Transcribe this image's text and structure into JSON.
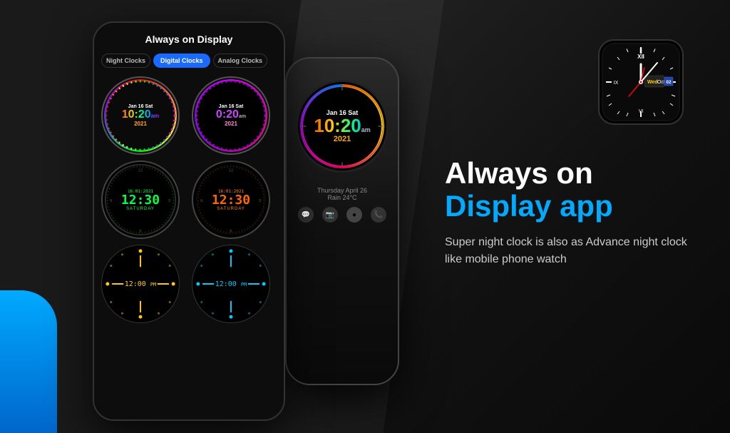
{
  "app": {
    "title": "Always on Display app"
  },
  "phone": {
    "screen_title": "Always on Display",
    "tabs": [
      {
        "label": "Night Clocks",
        "active": false
      },
      {
        "label": "Digital Clocks",
        "active": true
      },
      {
        "label": "Analog Clocks",
        "active": false
      }
    ]
  },
  "clocks": [
    {
      "id": "rainbow",
      "date": "Jan 16 Sat",
      "time": "10:20",
      "ampm": "am",
      "year": "2021",
      "color": "rainbow"
    },
    {
      "id": "purple",
      "date": "Jan 16 Sat",
      "time": "0:20",
      "ampm": "am",
      "year": "2021",
      "color": "purple"
    },
    {
      "id": "green-digital",
      "datetime": "16:01:2021",
      "time": "12:30",
      "day": "SATURDAY",
      "color": "green"
    },
    {
      "id": "orange-digital",
      "datetime": "16:01:2021",
      "time": "12:30",
      "day": "SATURDAY",
      "color": "orange"
    },
    {
      "id": "minimal-yellow",
      "time": "12:00",
      "ampm": "PM",
      "color": "yellow"
    },
    {
      "id": "minimal-cyan",
      "time": "12:00",
      "ampm": "PM",
      "color": "cyan"
    }
  ],
  "big_clock": {
    "date": "Jan 16 Sat",
    "time": "10:20",
    "ampm": "am",
    "year": "2021"
  },
  "weather": {
    "date": "Thursday April 26",
    "condition": "Rain 24°C"
  },
  "analog_watch": {
    "day": "Wed",
    "date": "Oct",
    "badge": "02"
  },
  "right_panel": {
    "headline_line1": "Always on",
    "headline_line2": "Display app",
    "subtitle": "Super night clock is also as Advance night clock like mobile phone watch"
  },
  "colors": {
    "accent_blue": "#00aaff",
    "white": "#ffffff",
    "dark_bg": "#1a1a1a"
  }
}
